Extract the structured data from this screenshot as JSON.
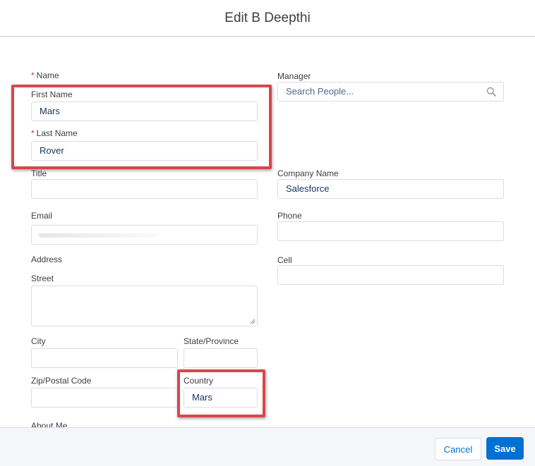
{
  "header": {
    "title": "Edit B Deepthi"
  },
  "form": {
    "name_label": "Name",
    "first_name": {
      "label": "First Name",
      "value": "Mars"
    },
    "last_name": {
      "label": "Last Name",
      "value": "Rover"
    },
    "title": {
      "label": "Title",
      "value": ""
    },
    "email": {
      "label": "Email",
      "value": ""
    },
    "address_label": "Address",
    "street": {
      "label": "Street",
      "value": ""
    },
    "city": {
      "label": "City",
      "value": ""
    },
    "state": {
      "label": "State/Province",
      "value": ""
    },
    "zip": {
      "label": "Zip/Postal Code",
      "value": ""
    },
    "country": {
      "label": "Country",
      "value": "Mars"
    },
    "about_me_label": "About Me",
    "manager": {
      "label": "Manager",
      "placeholder": "Search People..."
    },
    "company_name": {
      "label": "Company Name",
      "value": "Salesforce"
    },
    "phone": {
      "label": "Phone",
      "value": ""
    },
    "cell": {
      "label": "Cell",
      "value": ""
    },
    "required_marker": "*"
  },
  "footer": {
    "cancel_label": "Cancel",
    "save_label": "Save"
  },
  "colors": {
    "highlight": "#d9464a",
    "brand": "#0070d2",
    "required": "#c23934"
  },
  "icons": {
    "manager_search": "search-icon"
  }
}
